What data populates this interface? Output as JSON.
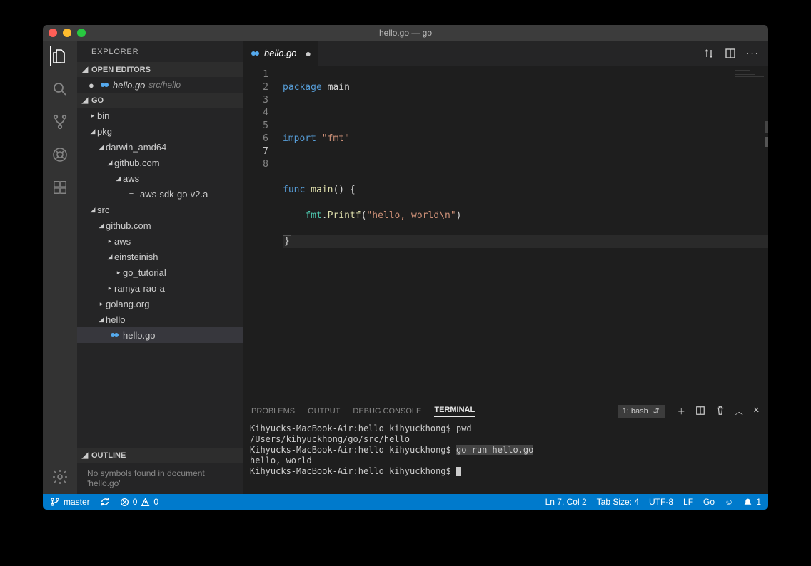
{
  "titlebar": {
    "title": "hello.go — go"
  },
  "sidebar": {
    "title": "EXPLORER",
    "open_editors_label": "OPEN EDITORS",
    "open_editors": [
      {
        "dirty": "●",
        "icon": "go",
        "name": "hello.go",
        "meta": "src/hello"
      }
    ],
    "workspace_label": "GO",
    "outline_label": "OUTLINE",
    "outline_msg": "No symbols found in document 'hello.go'"
  },
  "tree": {
    "l0": "bin",
    "l1": "pkg",
    "l2": "darwin_amd64",
    "l3": "github.com",
    "l4": "aws",
    "l5": "aws-sdk-go-v2.a",
    "l6": "src",
    "l7": "github.com",
    "l8": "aws",
    "l9": "einsteinish",
    "l10": "go_tutorial",
    "l11": "ramya-rao-a",
    "l12": "golang.org",
    "l13": "hello",
    "l14": "hello.go"
  },
  "tab": {
    "file_icon": "go",
    "file_name": "hello.go"
  },
  "code": {
    "ln1": "1",
    "ln2": "2",
    "ln3": "3",
    "ln4": "4",
    "ln5": "5",
    "ln6": "6",
    "ln7": "7",
    "ln8": "8",
    "l1_kw": "package",
    "l1_id": " main",
    "l3_kw": "import",
    "l3_str": " \"fmt\"",
    "l5_kw": "func ",
    "l5_fn": "main",
    "l5_rest": "() {",
    "l6_indent": "    ",
    "l6_pkg": "fmt",
    "l6_dot": ".",
    "l6_fn": "Printf",
    "l6_open": "(",
    "l6_str": "\"hello, world\\n\"",
    "l6_close": ")",
    "l7": "}"
  },
  "panel": {
    "tabs": {
      "problems": "PROBLEMS",
      "output": "OUTPUT",
      "debug": "DEBUG CONSOLE",
      "terminal": "TERMINAL"
    },
    "shell_label": "1: bash",
    "lines": {
      "p1a": "Kihyucks-MacBook-Air:hello kihyuckhong$ ",
      "p1b": "pwd",
      "p2": "/Users/kihyuckhong/go/src/hello",
      "p3a": "Kihyucks-MacBook-Air:hello kihyuckhong$ ",
      "p3b": "go run hello.go",
      "p4": "hello, world",
      "p5": "Kihyucks-MacBook-Air:hello kihyuckhong$ "
    }
  },
  "status": {
    "branch": "master",
    "errors": "0",
    "warnings": "0",
    "lncol": "Ln 7, Col 2",
    "tabsize": "Tab Size: 4",
    "encoding": "UTF-8",
    "eol": "LF",
    "lang": "Go",
    "notif": "1"
  }
}
